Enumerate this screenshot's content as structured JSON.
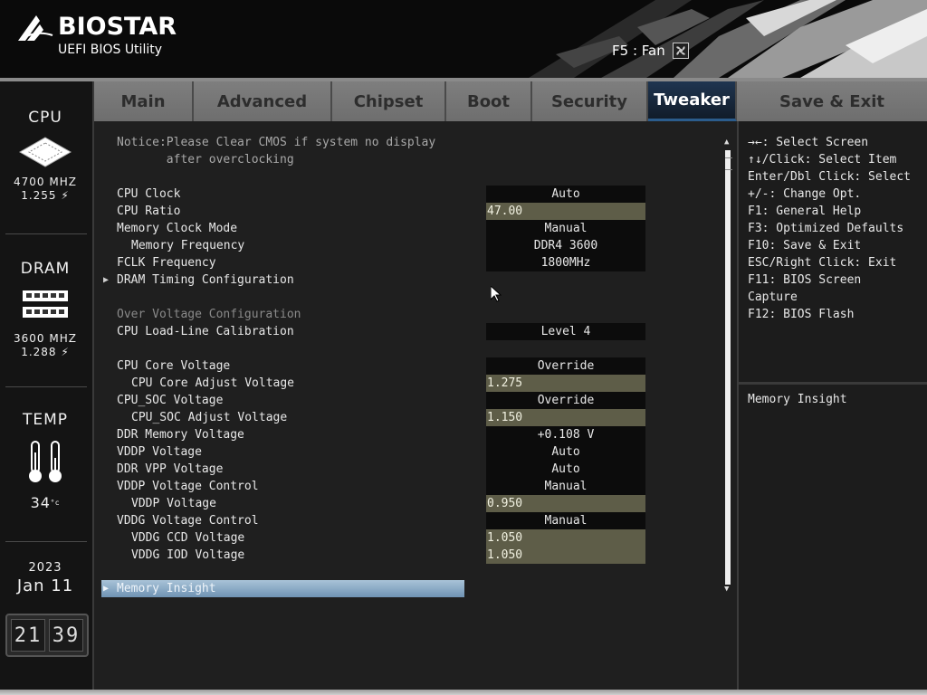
{
  "header": {
    "brand": "BIOSTAR",
    "subtitle": "UEFI BIOS Utility",
    "fan_hint": "F5 : Fan"
  },
  "status": {
    "cpu": {
      "title": "CPU",
      "freq": "4700 MHZ",
      "voltage": "1.255"
    },
    "dram": {
      "title": "DRAM",
      "freq": "3600 MHZ",
      "voltage": "1.288"
    },
    "temp": {
      "title": "TEMP",
      "value": "34"
    },
    "date": {
      "year": "2023",
      "month_day": "Jan 11"
    },
    "time": {
      "hour": "21",
      "minute": "39"
    }
  },
  "tabs": [
    {
      "label": "Main"
    },
    {
      "label": "Advanced"
    },
    {
      "label": "Chipset"
    },
    {
      "label": "Boot"
    },
    {
      "label": "Security"
    },
    {
      "label": "Tweaker",
      "active": true
    },
    {
      "label": "Save & Exit"
    }
  ],
  "notice": {
    "line1": "Notice:Please Clear CMOS if system no display",
    "line2": "       after overclocking"
  },
  "settings": [
    {
      "label": "CPU Clock",
      "value": "Auto"
    },
    {
      "label": "CPU Ratio",
      "value": "47.00"
    },
    {
      "label": "Memory Clock Mode",
      "value": "Manual"
    },
    {
      "label": "Memory Frequency",
      "value": "DDR4 3600"
    },
    {
      "label": "FCLK Frequency",
      "value": "1800MHz"
    },
    {
      "label": "DRAM Timing Configuration"
    },
    {
      "label": "Over Voltage Configuration"
    },
    {
      "label": "CPU Load-Line Calibration",
      "value": "Level 4"
    },
    {
      "label": "CPU Core Voltage",
      "value": "Override"
    },
    {
      "label": "CPU Core Adjust Voltage",
      "value": "1.275"
    },
    {
      "label": "CPU_SOC Voltage",
      "value": "Override"
    },
    {
      "label": "CPU_SOC Adjust Voltage",
      "value": "1.150"
    },
    {
      "label": "DDR Memory Voltage",
      "value": "+0.108 V"
    },
    {
      "label": "VDDP Voltage",
      "value": "Auto"
    },
    {
      "label": "DDR VPP Voltage",
      "value": "Auto"
    },
    {
      "label": "VDDP Voltage Control",
      "value": "Manual"
    },
    {
      "label": "VDDP Voltage",
      "value": "0.950"
    },
    {
      "label": "VDDG Voltage Control",
      "value": "Manual"
    },
    {
      "label": "VDDG CCD Voltage",
      "value": "1.050"
    },
    {
      "label": "VDDG IOD Voltage",
      "value": "1.050"
    }
  ],
  "selected_item": "Memory Insight",
  "help": {
    "keys": [
      "→←: Select Screen",
      "↑↓/Click: Select Item",
      "Enter/Dbl Click: Select",
      "+/-: Change Opt.",
      "F1: General Help",
      "F3: Optimized Defaults",
      "F10: Save & Exit",
      "ESC/Right Click: Exit",
      "F11: BIOS Screen",
      "Capture",
      "F12: BIOS Flash"
    ],
    "description": "Memory Insight"
  },
  "icons": {
    "cpu": "cpu-chip-icon",
    "dram": "dram-module-icon",
    "temp": "thermometer-icon",
    "fan": "fan-icon",
    "voltage": "lightning-icon"
  },
  "colors": {
    "active_tab": "#1f3550",
    "numeric_field": "#5e5d48",
    "selected_row": "#8eacc6"
  }
}
